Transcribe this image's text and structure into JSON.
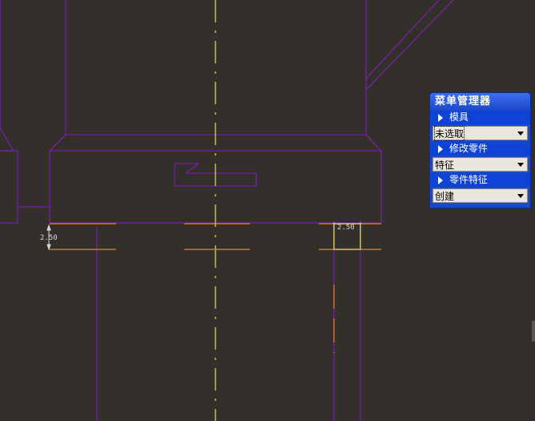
{
  "dimensions": {
    "left": "2.50",
    "right": "2.50"
  },
  "menu_manager": {
    "title": "菜单管理器",
    "sections": [
      {
        "label": "模具",
        "dropdown_value": "未选取"
      },
      {
        "label": "修改零件",
        "dropdown_value": "特征"
      },
      {
        "label": "零件特征",
        "dropdown_value": "创建"
      }
    ]
  },
  "colors": {
    "background": "#332f2b",
    "part_outline": "#7a1fa8",
    "centerline": "#e8e05a",
    "dimension_line": "#e8861f",
    "menu_blue": "#1b49c8"
  }
}
